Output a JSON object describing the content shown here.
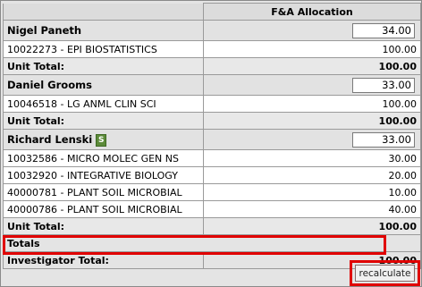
{
  "header": {
    "column_title": "F&A Allocation"
  },
  "investigators": [
    {
      "name": "Nigel Paneth",
      "percent": "34.00",
      "badge": "",
      "accounts": [
        {
          "label": "10022273 - EPI BIOSTATISTICS",
          "value": "100.00"
        }
      ],
      "unit_total_label": "Unit Total:",
      "unit_total": "100.00"
    },
    {
      "name": "Daniel Grooms",
      "percent": "33.00",
      "badge": "",
      "accounts": [
        {
          "label": "10046518 - LG ANML CLIN SCI",
          "value": "100.00"
        }
      ],
      "unit_total_label": "Unit Total:",
      "unit_total": "100.00"
    },
    {
      "name": "Richard Lenski",
      "percent": "33.00",
      "badge": "S",
      "accounts": [
        {
          "label": "10032586 - MICRO MOLEC GEN NS",
          "value": "30.00"
        },
        {
          "label": "10032920 - INTEGRATIVE BIOLOGY",
          "value": "20.00"
        },
        {
          "label": "40000781 - PLANT SOIL MICROBIAL",
          "value": "10.00"
        },
        {
          "label": "40000786 - PLANT SOIL MICROBIAL",
          "value": "40.00"
        }
      ],
      "unit_total_label": "Unit Total:",
      "unit_total": "100.00"
    }
  ],
  "totals": {
    "label": "Totals",
    "investigator_total_label": "Investigator Total:",
    "investigator_total": "100.00"
  },
  "actions": {
    "recalculate_label": "recalculate"
  },
  "colors": {
    "highlight": "#e00000",
    "badge": "#5d8b3a"
  }
}
